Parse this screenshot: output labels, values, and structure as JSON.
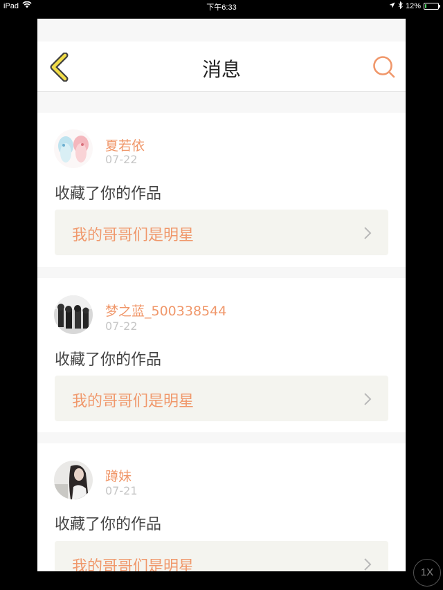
{
  "status_bar": {
    "device": "iPad",
    "time": "下午6:33",
    "battery_percent": "12%",
    "battery_level": 0.12
  },
  "navbar": {
    "title": "消息",
    "back_icon": "chevron-left-icon",
    "search_icon": "search-icon",
    "accent_color": "#f0976a"
  },
  "messages": [
    {
      "username": "夏若依",
      "date": "07-22",
      "action": "收藏了你的作品",
      "work_title": "我的哥哥们是明星"
    },
    {
      "username": "梦之蓝_500338544",
      "date": "07-22",
      "action": "收藏了你的作品",
      "work_title": "我的哥哥们是明星"
    },
    {
      "username": "蹲妹",
      "date": "07-21",
      "action": "收藏了你的作品",
      "work_title": "我的哥哥们是明星"
    }
  ],
  "zoom": {
    "label": "1X"
  }
}
